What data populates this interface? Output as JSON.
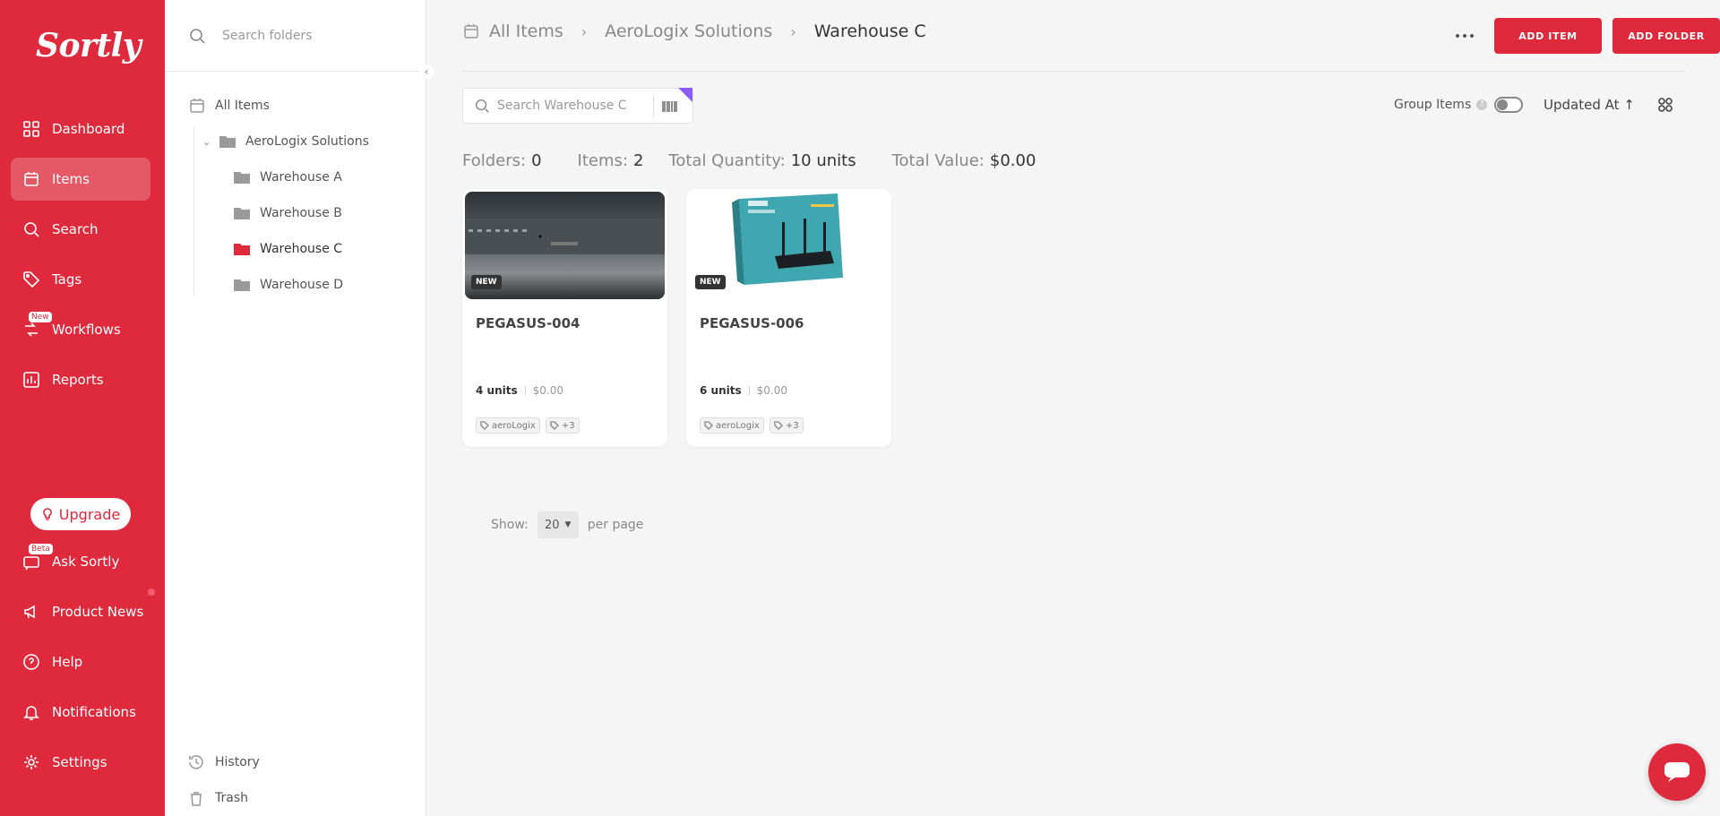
{
  "brand": {
    "name": "Sortly",
    "color": "#de2a3c"
  },
  "nav": {
    "items": [
      {
        "label": "Dashboard",
        "icon": "dashboard-icon"
      },
      {
        "label": "Items",
        "icon": "items-icon",
        "active": true
      },
      {
        "label": "Search",
        "icon": "search-icon"
      },
      {
        "label": "Tags",
        "icon": "tag-icon"
      },
      {
        "label": "Workflows",
        "icon": "workflows-icon",
        "badge": "New"
      },
      {
        "label": "Reports",
        "icon": "reports-icon"
      }
    ],
    "upgrade": "Upgrade",
    "bottom": [
      {
        "label": "Ask Sortly",
        "icon": "chat-bot-icon",
        "badge": "Beta"
      },
      {
        "label": "Product News",
        "icon": "megaphone-icon"
      },
      {
        "label": "Help",
        "icon": "help-icon"
      },
      {
        "label": "Notifications",
        "icon": "bell-icon"
      },
      {
        "label": "Settings",
        "icon": "gear-icon"
      }
    ]
  },
  "folders": {
    "search_placeholder": "Search folders",
    "tree": [
      {
        "label": "All Items"
      },
      {
        "label": "AeroLogix Solutions"
      },
      {
        "label": "Warehouse A"
      },
      {
        "label": "Warehouse B"
      },
      {
        "label": "Warehouse C",
        "selected": true
      },
      {
        "label": "Warehouse D"
      }
    ],
    "history": "History",
    "trash": "Trash"
  },
  "header": {
    "breadcrumb": [
      "All Items",
      "AeroLogix Solutions",
      "Warehouse C"
    ],
    "add_item": "ADD ITEM",
    "add_folder": "ADD FOLDER"
  },
  "toolbar": {
    "search_placeholder": "Search Warehouse C",
    "group_items": "Group Items",
    "sort": "Updated At"
  },
  "summary": {
    "folders_label": "Folders:",
    "folders": "0",
    "items_label": "Items:",
    "items": "2",
    "quantity_label": "Total Quantity:",
    "quantity": "10 units",
    "value_label": "Total Value:",
    "value": "$0.00"
  },
  "cards": [
    {
      "name": "PEGASUS-004",
      "badge": "NEW",
      "units": "4 units",
      "price": "$0.00",
      "tag": "aeroLogix",
      "more_tags": "+3"
    },
    {
      "name": "PEGASUS-006",
      "badge": "NEW",
      "units": "6 units",
      "price": "$0.00",
      "tag": "aeroLogix",
      "more_tags": "+3"
    }
  ],
  "pagination": {
    "show": "Show:",
    "per_page_value": "20",
    "per_page": "per page"
  }
}
